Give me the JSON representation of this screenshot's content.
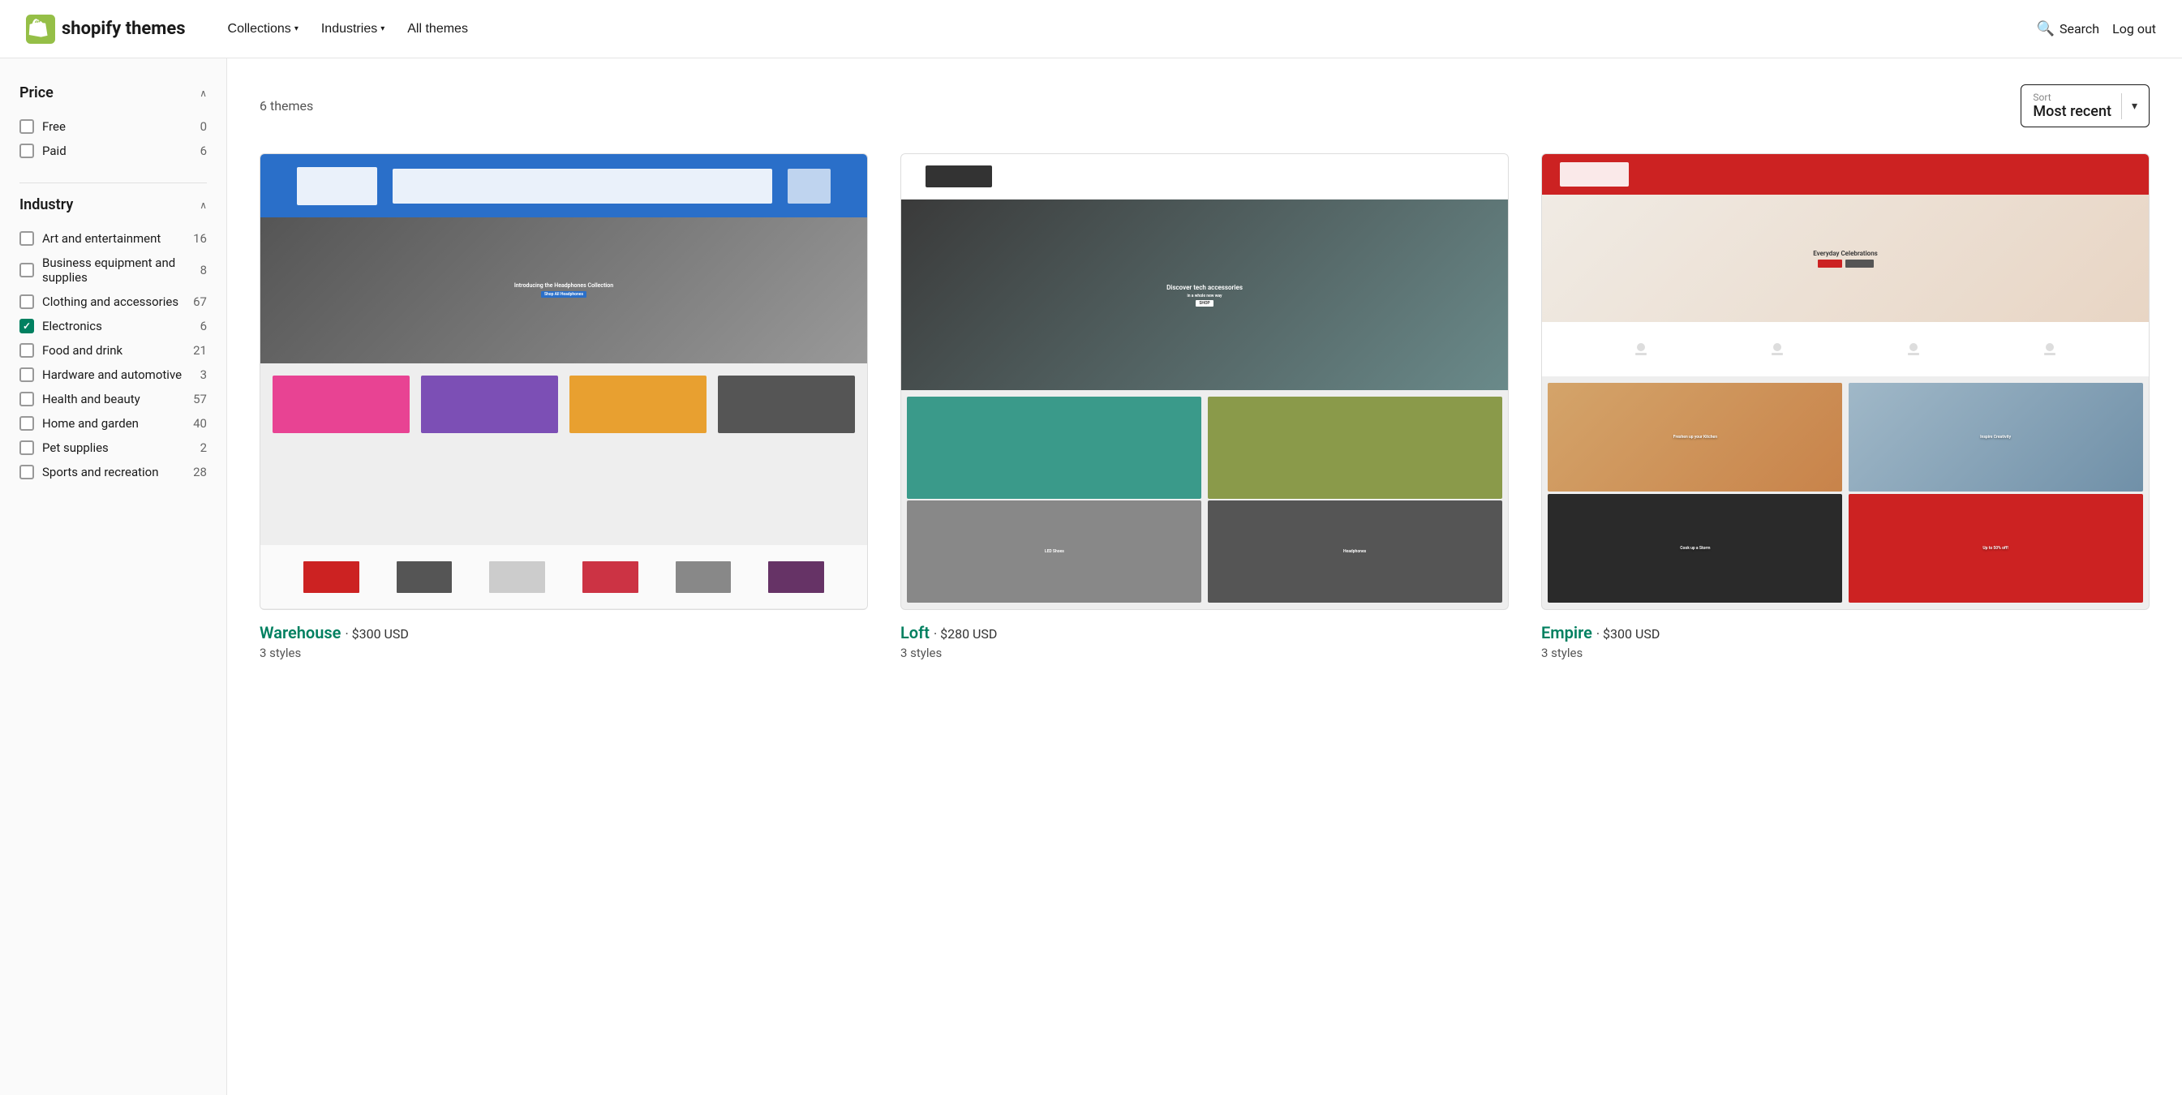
{
  "nav": {
    "logo_text_light": "shopify",
    "logo_text_bold": " themes",
    "links": [
      {
        "id": "collections",
        "label": "Collections",
        "hasChevron": true
      },
      {
        "id": "industries",
        "label": "Industries",
        "hasChevron": true
      },
      {
        "id": "all-themes",
        "label": "All themes",
        "hasChevron": false
      }
    ],
    "search_label": "Search",
    "logout_label": "Log out"
  },
  "sidebar": {
    "price_section": {
      "title": "Price",
      "items": [
        {
          "id": "free",
          "label": "Free",
          "count": "0",
          "checked": false
        },
        {
          "id": "paid",
          "label": "Paid",
          "count": "6",
          "checked": false
        }
      ]
    },
    "industry_section": {
      "title": "Industry",
      "items": [
        {
          "id": "art",
          "label": "Art and entertainment",
          "count": "16",
          "checked": false
        },
        {
          "id": "business",
          "label": "Business equipment and supplies",
          "count": "8",
          "checked": false
        },
        {
          "id": "clothing",
          "label": "Clothing and accessories",
          "count": "67",
          "checked": false
        },
        {
          "id": "electronics",
          "label": "Electronics",
          "count": "6",
          "checked": true
        },
        {
          "id": "food",
          "label": "Food and drink",
          "count": "21",
          "checked": false
        },
        {
          "id": "hardware",
          "label": "Hardware and automotive",
          "count": "3",
          "checked": false
        },
        {
          "id": "health",
          "label": "Health and beauty",
          "count": "57",
          "checked": false
        },
        {
          "id": "home",
          "label": "Home and garden",
          "count": "40",
          "checked": false
        },
        {
          "id": "pet",
          "label": "Pet supplies",
          "count": "2",
          "checked": false
        },
        {
          "id": "sports",
          "label": "Sports and recreation",
          "count": "28",
          "checked": false
        }
      ]
    }
  },
  "main": {
    "themes_count": "6 themes",
    "sort": {
      "label": "Sort",
      "value": "Most recent"
    },
    "themes": [
      {
        "id": "warehouse",
        "name": "Warehouse",
        "price": "$300 USD",
        "styles": "3 styles",
        "preview_type": "warehouse"
      },
      {
        "id": "loft",
        "name": "Loft",
        "price": "$280 USD",
        "styles": "3 styles",
        "preview_type": "loft"
      },
      {
        "id": "empire",
        "name": "Empire",
        "price": "$300 USD",
        "styles": "3 styles",
        "preview_type": "empire"
      }
    ]
  },
  "colors": {
    "accent": "#008060",
    "checked": "#008060",
    "link": "#008060"
  }
}
